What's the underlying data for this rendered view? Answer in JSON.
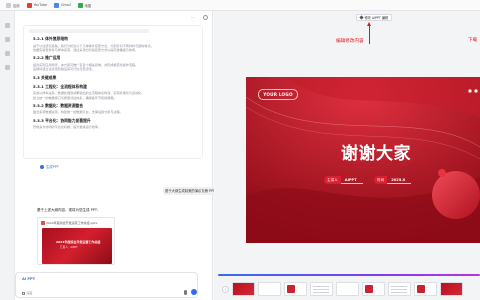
{
  "bookmarks": [
    {
      "label": "应用",
      "icon": "apps-icon"
    },
    {
      "label": "YouTube",
      "icon": "youtube-icon"
    },
    {
      "label": "Gmail",
      "icon": "gmail-icon"
    },
    {
      "label": "地图",
      "icon": "maps-icon"
    }
  ],
  "chat": {
    "doc_sections": [
      {
        "heading": "5.2.1 体外复原结构",
        "lines": [
          "基于以往研究思路，我们分析出以下几种体外复原方法，分别针对不同材料与结构特点。",
          "依据实验室条件与样本来源，建议采用分阶段复原方式以提高准确度与效率。"
        ]
      },
      {
        "heading": "5.2.2 推广运用",
        "lines": [
          "结合实际应用场景，本方案可推广至多个相关领域，并形成规范化操作流程。",
          "后续将通过试点项目验证其可行性与稳定性。"
        ]
      },
      {
        "heading": "5.3 关键成果",
        "lines": []
      },
      {
        "heading": "5.3.1 工程化：全流程体系构建",
        "lines": [
          "完成从样本采集、数据处理到成果输出的全流程体系构建，实现标准化与自动化。",
          "建立统一的数据接口与质量评估体系，确保各环节衔接顺畅。"
        ]
      },
      {
        "heading": "5.3.2 数据化：数据资源整合",
        "lines": [
          "整合多源数据资源，构建统一的数据平台，支撑后续分析与决策。"
        ]
      },
      {
        "heading": "5.3.3 平台化：协同能力显著提升",
        "lines": [
          "形成多方协同的平台化机制，提升整体运行效率。"
        ]
      }
    ],
    "generate_link": "生成PPT",
    "user_message": "基于大纲生成精美的演示文稿 PPT",
    "outline_response": "基于上述大纲内容，现将为您生成 PPT：",
    "file_name": "2024年度综合开发运营工作总结.pptx",
    "file_thumb_title": "2024年度综合开发运营工作总结",
    "file_thumb_subtitle": "汇报人：AIPPT",
    "composer_tag": "AI PPT",
    "composer_mode": "深度",
    "icons": {
      "send": "send-icon",
      "mic": "mic-icon",
      "settings": "settings-icon"
    }
  },
  "preview": {
    "edit_button": "修改 AIPPT 编辑",
    "annotation_left": "编辑修改内容",
    "annotation_right": "下载",
    "slide": {
      "logo": "YOUR LOGO",
      "title": "谢谢大家",
      "presenter_label": "主讲人",
      "presenter_value": "AIPPT",
      "time_label": "时间",
      "time_value": "2025.X",
      "accent_color": "#a3101c"
    },
    "thumbnails": [
      "red",
      "white",
      "mix",
      "lines",
      "white",
      "mix",
      "lines",
      "mix",
      "red"
    ]
  },
  "colors": {
    "accent_blue": "#3b6fe0",
    "annotation_red": "#e0161e"
  }
}
